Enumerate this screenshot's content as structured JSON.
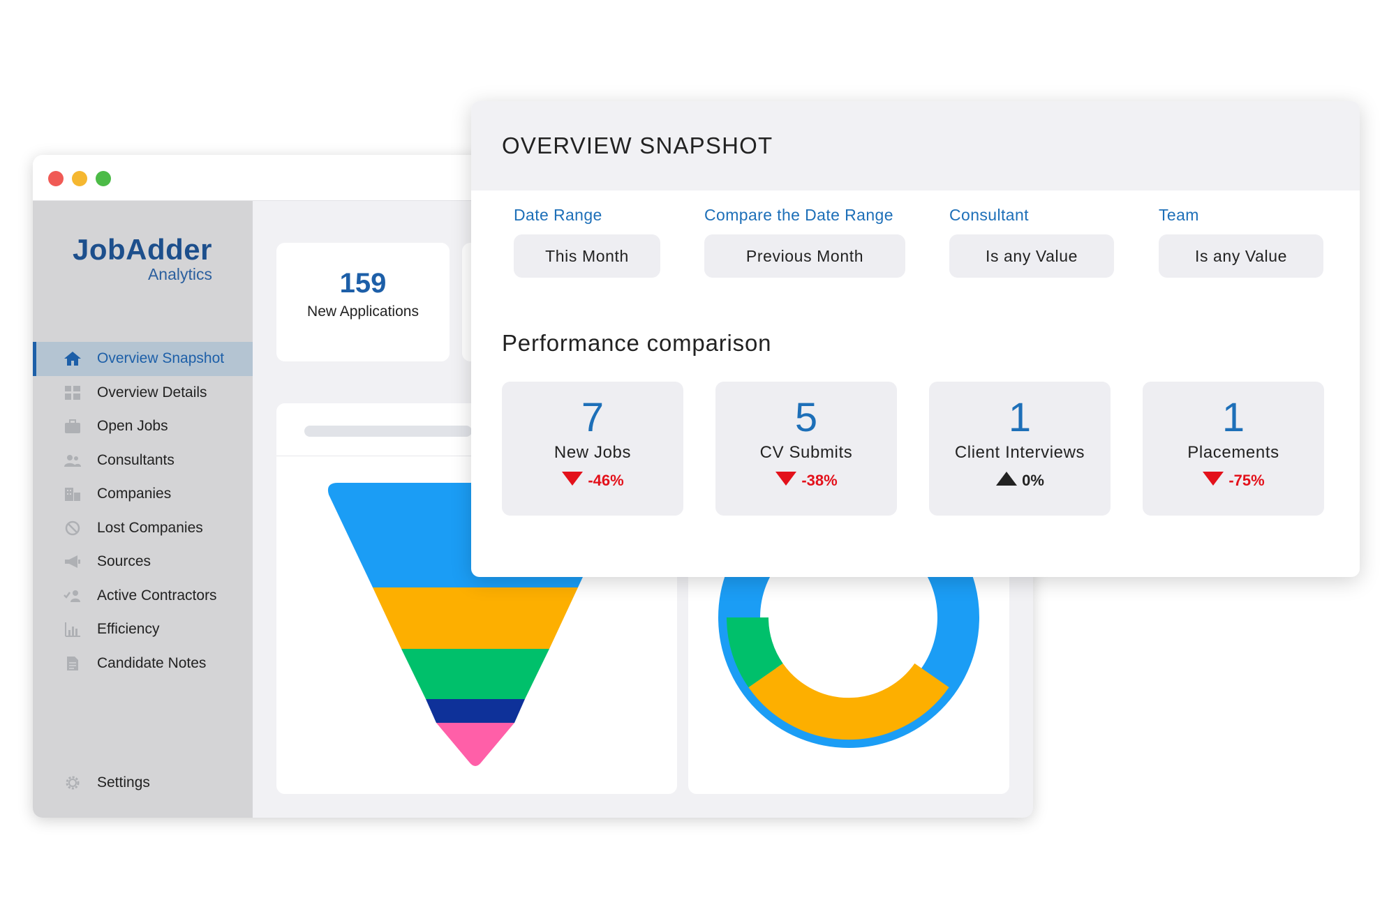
{
  "window": {
    "logo": {
      "main": "JobAdder",
      "sub": "Analytics"
    },
    "nav": [
      {
        "label": "Overview Snapshot",
        "icon": "home-icon",
        "active": true
      },
      {
        "label": "Overview Details",
        "icon": "grid-icon"
      },
      {
        "label": "Open Jobs",
        "icon": "briefcase-icon"
      },
      {
        "label": "Consultants",
        "icon": "users-icon"
      },
      {
        "label": "Companies",
        "icon": "building-icon"
      },
      {
        "label": "Lost Companies",
        "icon": "ban-icon"
      },
      {
        "label": "Sources",
        "icon": "megaphone-icon"
      },
      {
        "label": "Active Contractors",
        "icon": "user-check-icon"
      },
      {
        "label": "Efficiency",
        "icon": "bar-chart-icon"
      },
      {
        "label": "Candidate Notes",
        "icon": "document-icon"
      }
    ],
    "settings": {
      "label": "Settings",
      "icon": "gear-icon"
    },
    "stat": {
      "value": "159",
      "label": "New Applications"
    }
  },
  "panel": {
    "title": "OVERVIEW SNAPSHOT",
    "filters": [
      {
        "label": "Date Range",
        "value": "This Month"
      },
      {
        "label": "Compare the Date Range",
        "value": "Previous Month"
      },
      {
        "label": "Consultant",
        "value": "Is any Value"
      },
      {
        "label": "Team",
        "value": "Is any Value"
      }
    ],
    "perf_title": "Performance comparison",
    "kpis": [
      {
        "value": "7",
        "label": "New Jobs",
        "change": "-46%",
        "direction": "down"
      },
      {
        "value": "5",
        "label": "CV Submits",
        "change": "-38%",
        "direction": "down"
      },
      {
        "value": "1",
        "label": "Client Interviews",
        "change": "0%",
        "direction": "flat"
      },
      {
        "value": "1",
        "label": "Placements",
        "change": "-75%",
        "direction": "down"
      }
    ]
  },
  "colors": {
    "blue": "#1b9df5",
    "amber": "#fdaf00",
    "green": "#00c06b",
    "navy": "#0e3199",
    "pink": "#ff5fa8",
    "accent": "#1d6fb8",
    "down": "#e3111b"
  }
}
